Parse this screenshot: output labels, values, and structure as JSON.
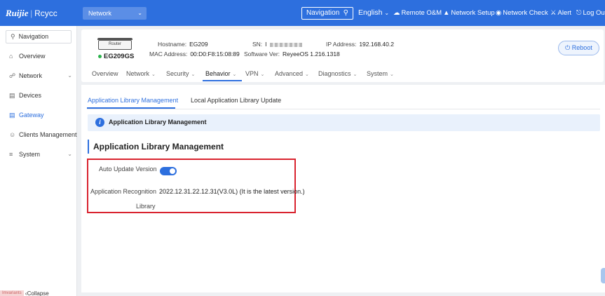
{
  "header": {
    "logo_brand": "Ruijie",
    "logo_sep": "|",
    "logo_brand2": "Rcycc",
    "network_select": "Network",
    "navigation_button": "Navigation",
    "language": "English",
    "links": {
      "remote": "Remote O&M",
      "setup": "Network Setup",
      "check": "Network Check",
      "alert": "Alert",
      "logout": "Log Out"
    }
  },
  "sidebar": {
    "search_label": "Navigation",
    "items": [
      "Overview",
      "Network",
      "Devices",
      "Gateway",
      "Clients Management",
      "System"
    ],
    "collapse_badge": "Imvariants",
    "collapse_label": "Collapse"
  },
  "device": {
    "router_label": "Router",
    "model": "EG209GS",
    "hostname_label": "Hostname:",
    "hostname": "EG209",
    "mac_label": "MAC Address:",
    "mac": "00:D0:F8:15:08:89",
    "sn_label": "SN:",
    "sn_prefix": "I",
    "software_label": "Software Ver:",
    "software": "ReyeeOS 1.216.1318",
    "ip_label": "IP Address:",
    "ip": "192.168.40.2",
    "reboot_label": "Reboot"
  },
  "tabs": [
    "Overview",
    "Network",
    "Security",
    "Behavior",
    "VPN",
    "Advanced",
    "Diagnostics",
    "System"
  ],
  "subtabs": [
    "Application Library Management",
    "Local Application Library Update"
  ],
  "info_bar": "Application Library Management",
  "section_title": "Application Library Management",
  "form": {
    "auto_update_label": "Auto Update Version",
    "auto_update_on": true,
    "recognition_label_1": "Application Recognition",
    "recognition_label_2": "Library",
    "recognition_value": "2022.12.31.22.12.31(V3.0L) (It is the latest version.)"
  },
  "colors": {
    "primary": "#2d6fde",
    "highlight": "#d9232f",
    "online": "#2bb24c"
  }
}
